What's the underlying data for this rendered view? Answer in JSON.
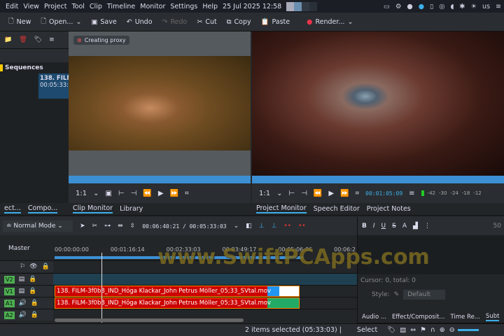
{
  "menubar": {
    "items": [
      "Edit",
      "View",
      "Project",
      "Tool",
      "Clip",
      "Timeline",
      "Monitor",
      "Settings",
      "Help"
    ],
    "clock": "25 Jul 2025 12:58",
    "tray_lang": "us"
  },
  "toolbar": {
    "new": "New",
    "open": "Open...",
    "save": "Save",
    "undo": "Undo",
    "redo": "Redo",
    "cut": "Cut",
    "copy": "Copy",
    "paste": "Paste",
    "render": "Render..."
  },
  "bin": {
    "folder": "Sequences",
    "clip_name": "138. FILM",
    "clip_duration": "00:05:33:0"
  },
  "clip_monitor": {
    "proxy_notice": "Creating proxy",
    "zoom": "1:1",
    "tabs": [
      "Clip Monitor",
      "Library"
    ]
  },
  "project_monitor": {
    "zoom": "1:1",
    "timecode": "00:01:05:09",
    "vu_ticks": [
      "-42",
      "-30",
      "-24",
      "-18",
      "-12"
    ],
    "tabs": [
      "Project Monitor",
      "Speech Editor",
      "Project Notes"
    ]
  },
  "left_tabs": [
    "ect...",
    "Compo..."
  ],
  "timeline": {
    "mode": "Normal Mode",
    "position": "00:06:40:21 / 00:05:33:03",
    "master": "Master",
    "ruler": [
      "00:00:00:00",
      "00:01:16:14",
      "00:02:33:03",
      "00:03:49:17",
      "00:05:06:06",
      "00:06:2"
    ],
    "tracks": [
      "V2",
      "V1",
      "A1",
      "A2"
    ],
    "clips": {
      "video": "138. FILM-3f0b8_IND_Höga Klackar_John Petrus Möller_05;33_SVtal.mov",
      "audio": "138. FILM-3f0b8_IND_Höga Klackar_John Petrus Möller_05;33_SVtal.mov"
    }
  },
  "subtitle_panel": {
    "font_size": "50",
    "cursor": "Cursor: 0, total: 0",
    "style_label": "Style:",
    "style_value": "Default",
    "tabs": [
      "Audio ...",
      "Effect/Composit...",
      "Time Re...",
      "Subt"
    ]
  },
  "status": {
    "selection": "2 items selected (05:33:03) |",
    "tool": "Select"
  },
  "watermark": "www.SwiftPCApps.com",
  "colors": {
    "accent": "#3daee9",
    "clip": "#cc0000",
    "track_label": "#4caf50"
  }
}
